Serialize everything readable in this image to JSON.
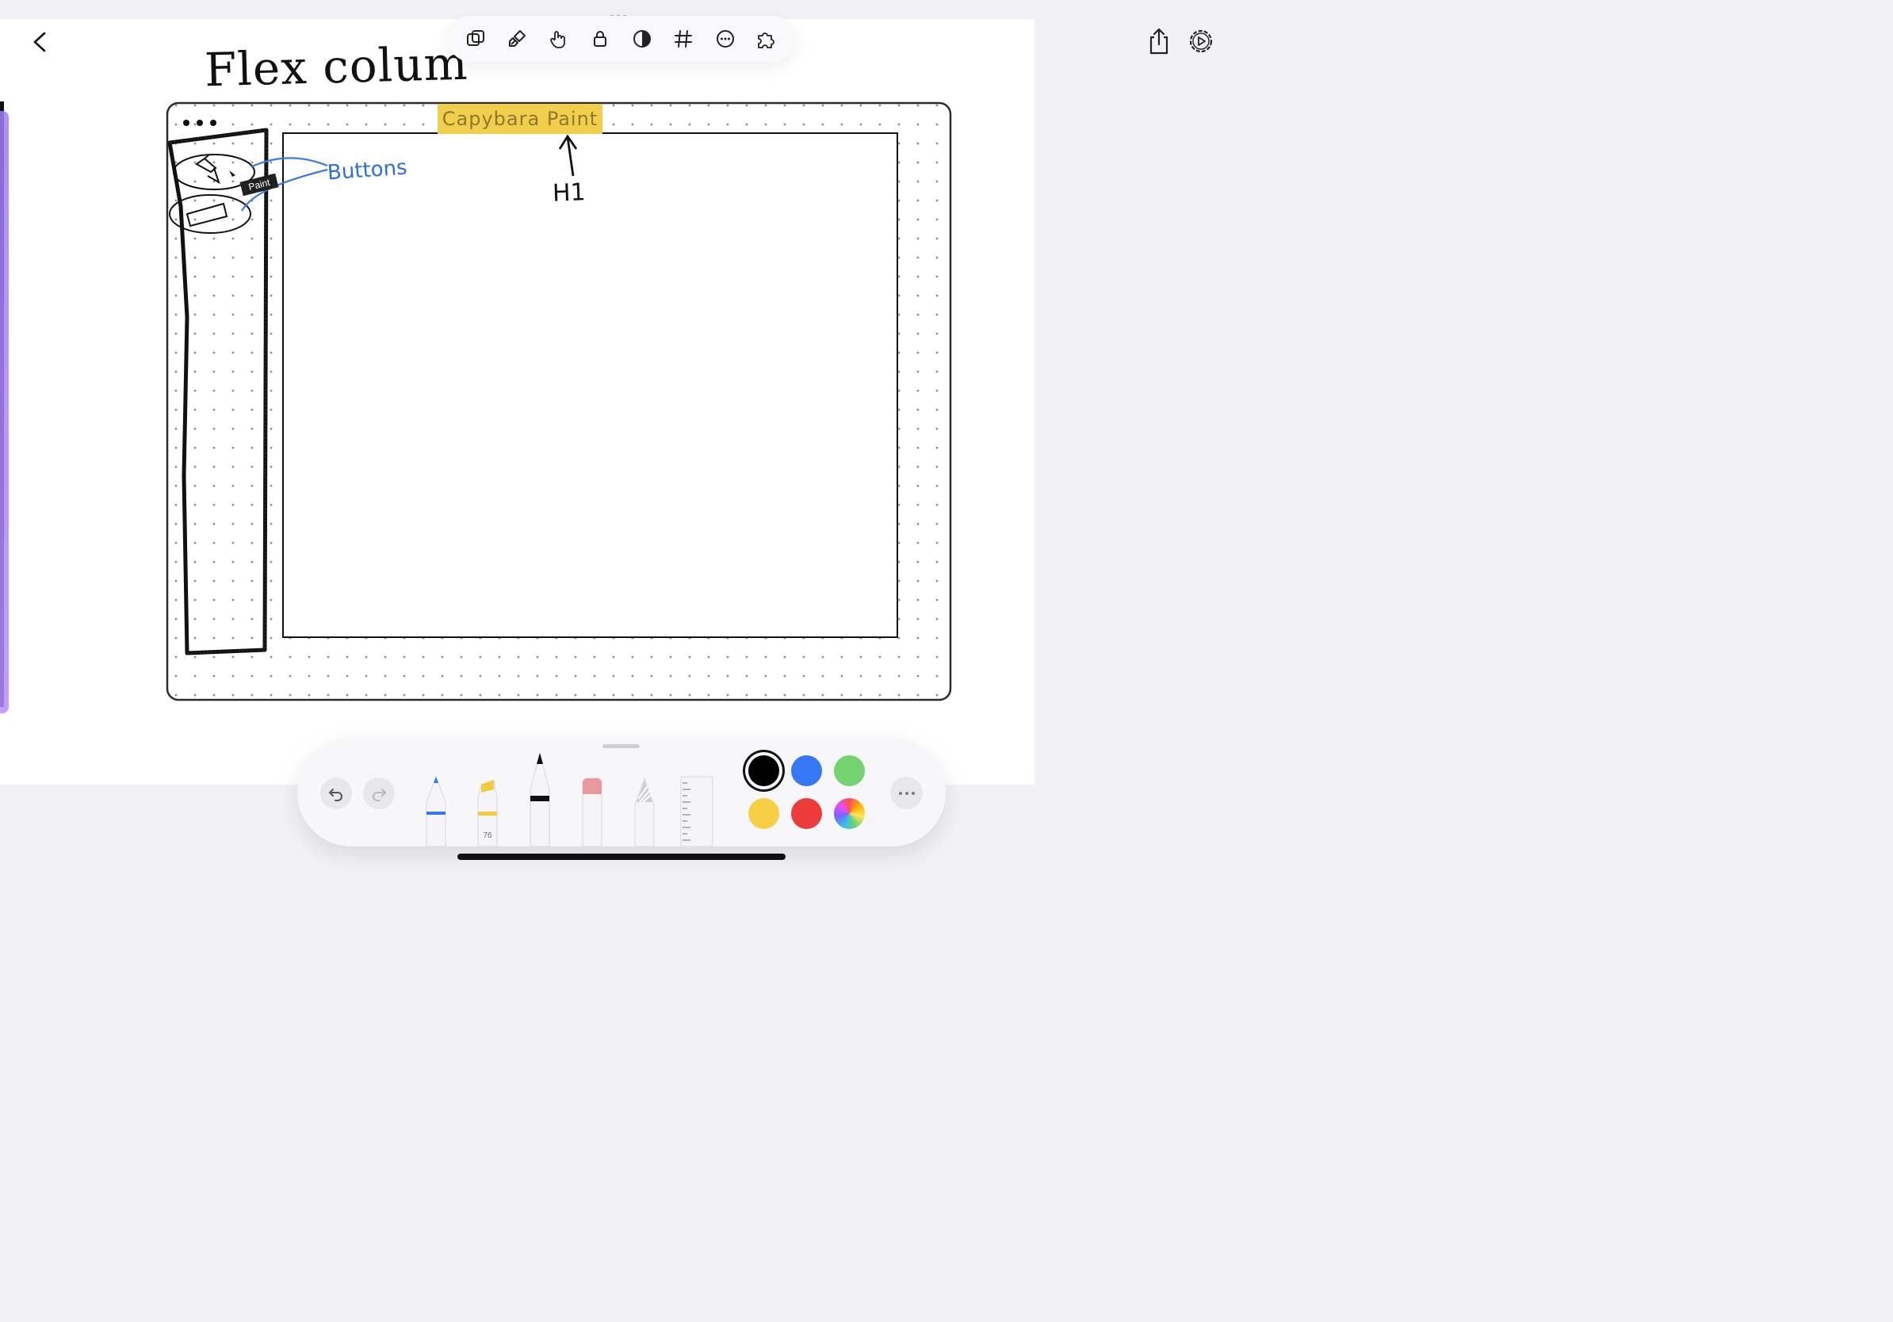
{
  "toolbar": {
    "icons": [
      "shapes-icon",
      "brush-icon",
      "hand-pointer-icon",
      "lock-icon",
      "contrast-icon",
      "grid-icon",
      "more-circle-icon",
      "puzzle-icon"
    ]
  },
  "sketch": {
    "title": "Flex colum",
    "h1_tag": "Capybara Paint",
    "annotation_buttons": "Buttons",
    "annotation_h1": "H1",
    "tooltip": "Paint"
  },
  "palette": {
    "highlighter_size": "76",
    "colors": {
      "black": "#000000",
      "blue": "#3478f6",
      "green": "#73d36f",
      "yellow": "#f7cf45",
      "red": "#eb3b3b"
    }
  }
}
